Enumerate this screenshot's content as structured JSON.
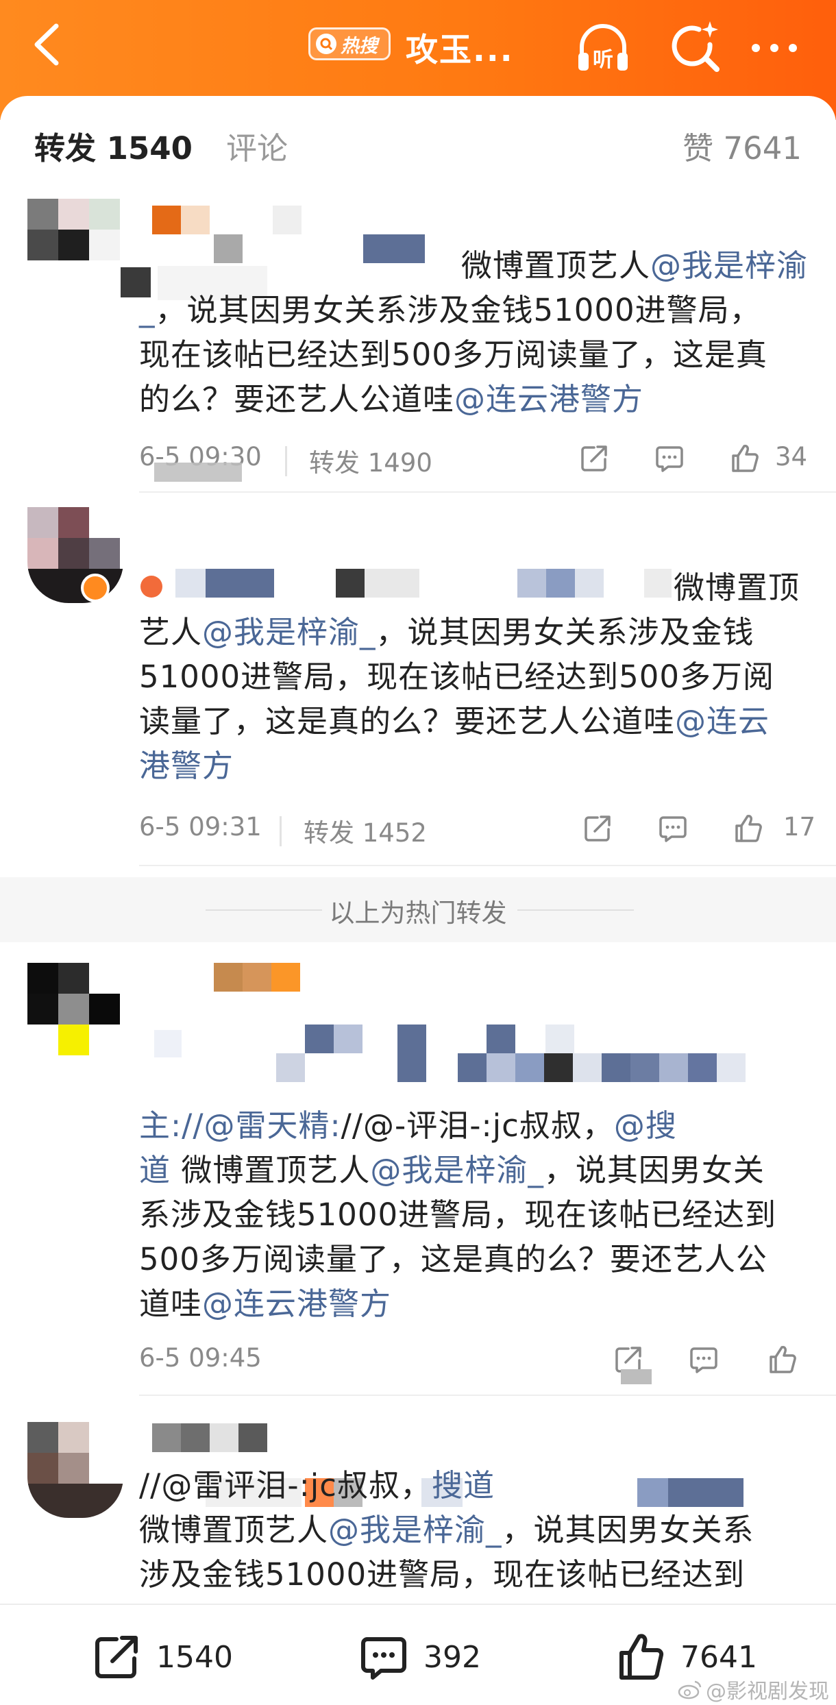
{
  "header": {
    "hot_badge": "热搜",
    "title": "攻玉...",
    "accent": "#ff7a12"
  },
  "tabs": {
    "repost": "转发 1540",
    "comment": "评论",
    "likes": "赞 7641"
  },
  "posts": [
    {
      "lines": [
        [
          {
            "t": "微博置顶艺人"
          },
          {
            "t": "@我是梓渝",
            "link": true
          }
        ],
        [
          {
            "t": "_",
            "link": true
          },
          {
            "t": "，说其因男女关系涉及金钱51000进警局，"
          }
        ],
        [
          {
            "t": "现在该帖已经达到500多万阅读量了，这是真"
          }
        ],
        [
          {
            "t": "的么？要还艺人公道哇"
          },
          {
            "t": "@连云港警方",
            "link": true
          }
        ]
      ],
      "time": "6-5 09:30",
      "repost": "转发 1490",
      "likes": "34"
    },
    {
      "lines": [
        [
          {
            "t": "微博置顶"
          }
        ],
        [
          {
            "t": "艺人"
          },
          {
            "t": "@我是梓渝_",
            "link": true
          },
          {
            "t": "，说其因男女关系涉及金钱"
          }
        ],
        [
          {
            "t": "51000进警局，现在该帖已经达到500多万阅"
          }
        ],
        [
          {
            "t": "读量了，这是真的么？要还艺人公道哇"
          },
          {
            "t": "@连云",
            "link": true
          }
        ],
        [
          {
            "t": "港警方",
            "link": true
          }
        ]
      ],
      "time": "6-5 09:31",
      "repost": "转发 1452",
      "likes": "17"
    },
    {
      "lines": [
        [
          {
            "t": "主://@雷天精:",
            "link": true
          },
          {
            "t": "//@-评泪-:jc叔叔，"
          },
          {
            "t": "@搜",
            "link": true
          }
        ],
        [
          {
            "t": "道",
            "link": true
          },
          {
            "t": " 微博置顶艺人"
          },
          {
            "t": "@我是梓渝_",
            "link": true
          },
          {
            "t": "，说其因男女关"
          }
        ],
        [
          {
            "t": "系涉及金钱51000进警局，现在该帖已经达到"
          }
        ],
        [
          {
            "t": "500多万阅读量了，这是真的么？要还艺人公"
          }
        ],
        [
          {
            "t": "道哇"
          },
          {
            "t": "@连云港警方",
            "link": true
          }
        ]
      ],
      "time": "6-5 09:45",
      "repost": "",
      "likes": ""
    },
    {
      "lines": [
        [
          {
            "t": "//@雷"
          },
          {
            "t": "评泪-:jc叔叔，"
          },
          {
            "t": "搜道",
            "link": true
          }
        ],
        [
          {
            "t": "微博置顶艺人"
          },
          {
            "t": "@我是梓渝_",
            "link": true
          },
          {
            "t": "，说其因男女关系"
          }
        ],
        [
          {
            "t": "涉及金钱51000进警局，现在该帖已经达到"
          }
        ]
      ],
      "time": "",
      "repost": "",
      "likes": ""
    }
  ],
  "hot_divider_label": "以上为热门转发",
  "bottom_bar": {
    "repost_count": "1540",
    "comment_count": "392",
    "like_count": "7641"
  },
  "watermark": "@影视剧发现"
}
